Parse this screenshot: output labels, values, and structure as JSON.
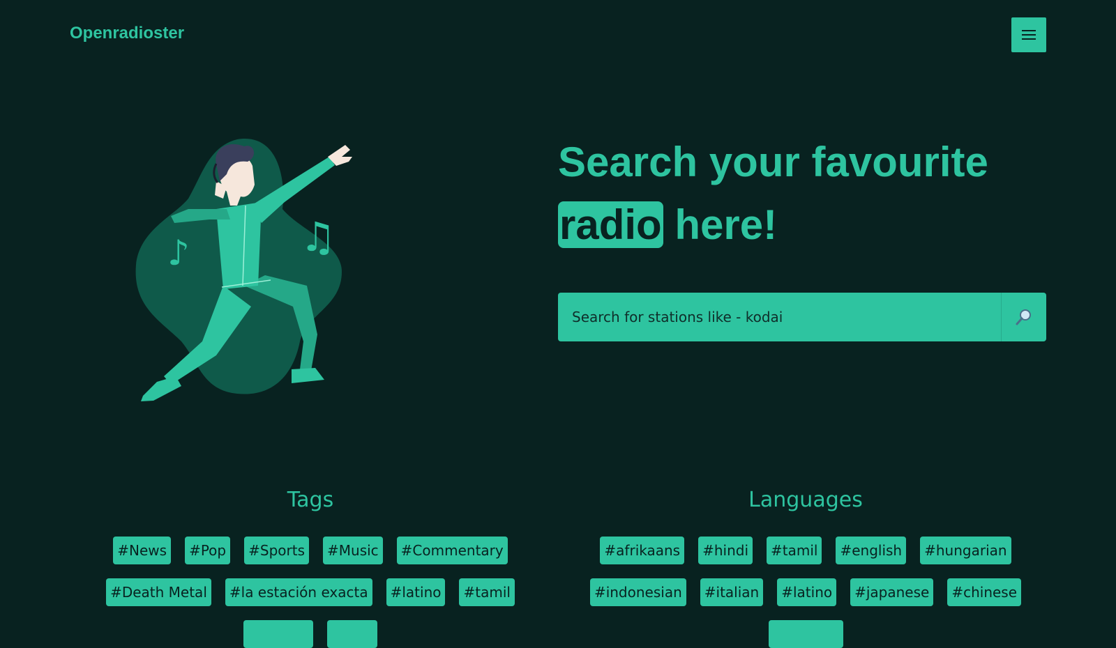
{
  "header": {
    "brand": "Openradioster",
    "menu_icon": "hamburger-icon"
  },
  "hero": {
    "title_line1": "Search your favourite",
    "title_highlight": "radio",
    "title_rest": " here!"
  },
  "search": {
    "placeholder": "Search for stations like - kodai",
    "value": "",
    "icon": "magnifier-icon"
  },
  "tags": {
    "title": "Tags",
    "items": [
      "#News",
      "#Pop",
      "#Sports",
      "#Music",
      "#Commentary",
      "#Death Metal",
      "#la estación exacta",
      "#latino",
      "#tamil",
      "",
      ""
    ]
  },
  "languages": {
    "title": "Languages",
    "items": [
      "#afrikaans",
      "#hindi",
      "#tamil",
      "#english",
      "#hungarian",
      "#indonesian",
      "#italian",
      "#latino",
      "#japanese",
      "#chinese",
      ""
    ]
  },
  "colors": {
    "background": "#082220",
    "accent": "#2ec4a0",
    "blob": "#0f5a4a"
  }
}
